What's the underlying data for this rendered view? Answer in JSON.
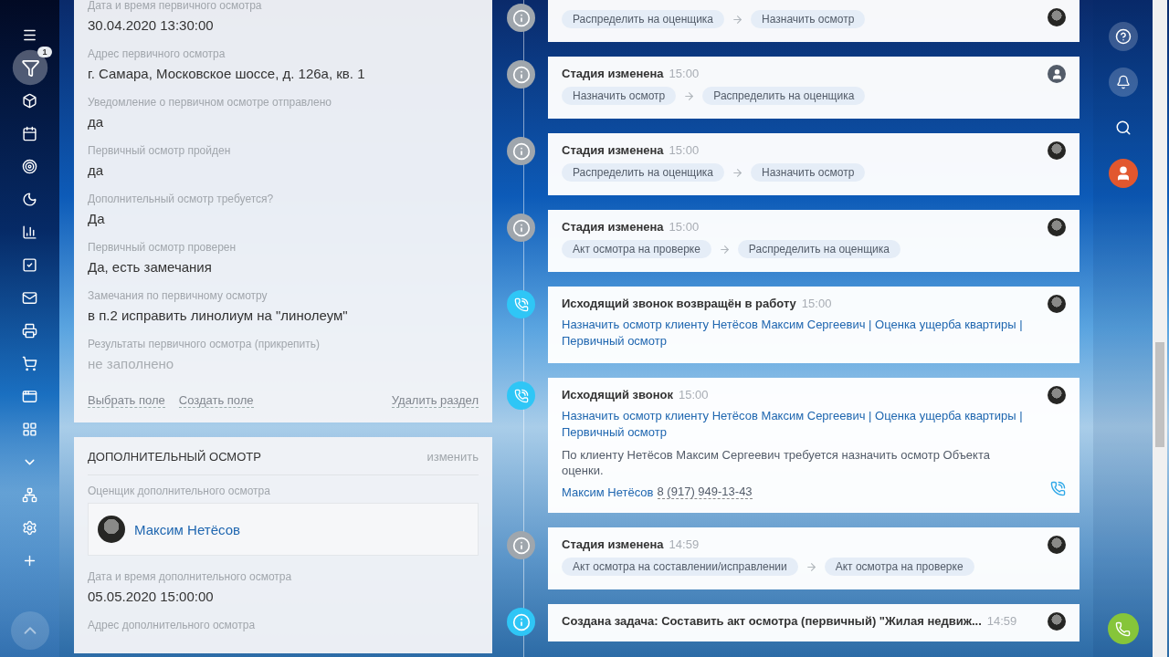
{
  "nav": [
    {
      "selected": false
    },
    {
      "selected": true,
      "badge": "1"
    },
    {
      "selected": false
    },
    {
      "selected": false
    },
    {
      "selected": false
    },
    {
      "selected": false
    },
    {
      "selected": false
    },
    {
      "selected": false
    },
    {
      "selected": false
    },
    {
      "selected": false
    },
    {
      "selected": false
    },
    {
      "selected": false
    },
    {
      "selected": false
    },
    {
      "selected": false
    },
    {
      "selected": false
    },
    {
      "selected": false
    },
    {
      "selected": false
    }
  ],
  "sections": [
    {
      "fields": [
        {
          "label": "Дата и время первичного осмотра",
          "value": "30.04.2020 13:30:00",
          "empty": false
        },
        {
          "label": "Адрес первичного осмотра",
          "value": "г. Самара, Московское шоссе, д. 126а, кв. 1",
          "empty": false
        },
        {
          "label": "Уведомление о первичном осмотре отправлено",
          "value": "да",
          "empty": false
        },
        {
          "label": "Первичный осмотр пройден",
          "value": "да",
          "empty": false
        },
        {
          "label": "Дополнительный осмотр требуется?",
          "value": "Да",
          "empty": false
        },
        {
          "label": "Первичный осмотр проверен",
          "value": "Да, есть замечания",
          "empty": false
        },
        {
          "label": "Замечания по первичному осмотру",
          "value": "в п.2 исправить линолиум на \"линолеум\"",
          "empty": false
        },
        {
          "label": "Результаты первичного осмотра (прикрепить)",
          "value": "не заполнено",
          "empty": true
        }
      ],
      "actions": [
        "Выбрать поле",
        "Создать поле"
      ],
      "delete": "Удалить раздел"
    },
    {
      "title": "ДОПОЛНИТЕЛЬНЫЙ ОСМОТР",
      "edit": "изменить",
      "fields": [
        {
          "label": "Оценщик дополнительного осмотра",
          "person": "Максим Нетёсов",
          "kind": "person"
        },
        {
          "label": "Дата и время дополнительного осмотра",
          "value": "05.05.2020 15:00:00",
          "empty": false
        },
        {
          "label": "Адрес дополнительного осмотра"
        }
      ]
    }
  ],
  "timeline": [
    {
      "kind": "stage",
      "author_photo": true,
      "from": "Распределить на оценщика",
      "to": "Назначить осмотр"
    },
    {
      "kind": "stage",
      "title": "Стадия изменена",
      "time": "15:00",
      "author_photo": false,
      "from": "Назначить осмотр",
      "to": "Распределить на оценщика"
    },
    {
      "kind": "stage",
      "title": "Стадия изменена",
      "time": "15:00",
      "author_photo": true,
      "from": "Распределить на оценщика",
      "to": "Назначить осмотр"
    },
    {
      "kind": "stage",
      "title": "Стадия изменена",
      "time": "15:00",
      "author_photo": true,
      "from": "Акт осмотра на проверке",
      "to": "Распределить на оценщика"
    },
    {
      "kind": "call",
      "title": "Исходящий звонок возвращён в работу",
      "time": "15:00",
      "author_photo": true,
      "link": "Назначить осмотр клиенту Нетёсов Максим Сергеевич | Оценка ущерба квартиры | Первичный осмотр"
    },
    {
      "kind": "call",
      "title": "Исходящий звонок",
      "time": "15:00",
      "author_photo": true,
      "link": "Назначить осмотр клиенту Нетёсов Максим Сергеевич | Оценка ущерба квартиры | Первичный осмотр",
      "description": "По клиенту Нетёсов Максим Сергеевич требуется назначить осмотр Объекта оценки.",
      "contact": "Максим Нетёсов",
      "phone": "8 (917) 949-13-43"
    },
    {
      "kind": "stage",
      "title": "Стадия изменена",
      "time": "14:59",
      "author_photo": true,
      "from": "Акт осмотра на составлении/исправлении",
      "to": "Акт осмотра на проверке"
    },
    {
      "kind": "task",
      "title": "Создана задача: Составить акт осмотра (первичный) \"Жилая недвиж...",
      "time": "14:59",
      "author_photo": true
    }
  ]
}
